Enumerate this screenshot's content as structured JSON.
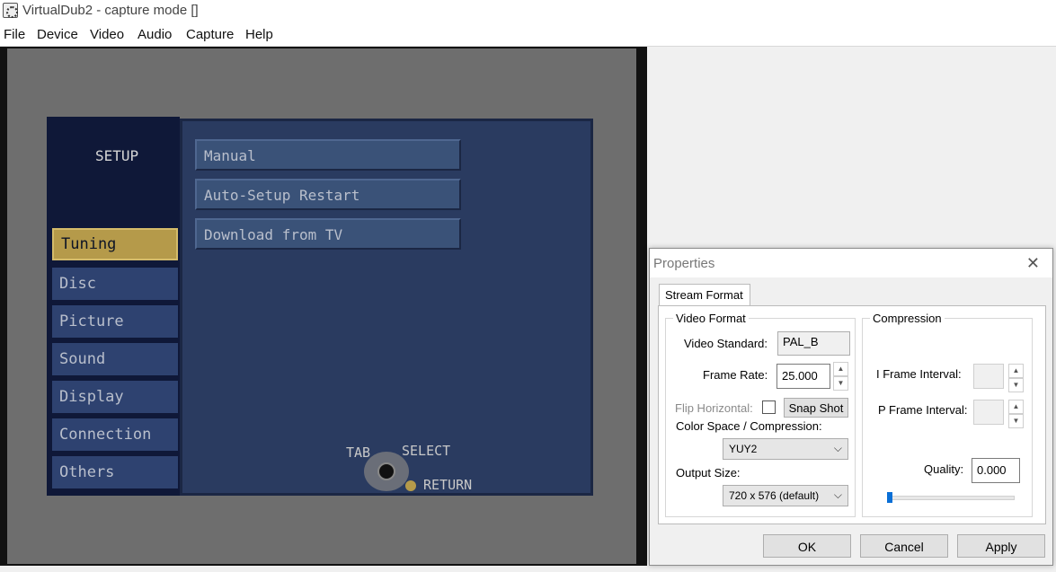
{
  "window": {
    "title": "VirtualDub2  - capture mode []"
  },
  "menu": [
    "File",
    "Device",
    "Video",
    "Audio",
    "Capture",
    "Help"
  ],
  "osd": {
    "title": "SETUP",
    "tabs": [
      "Tuning",
      "Disc",
      "Picture",
      "Sound",
      "Display",
      "Connection",
      "Others"
    ],
    "options": [
      "Manual",
      "Auto-Setup Restart",
      "Download from TV"
    ],
    "nav": {
      "tab": "TAB",
      "select": "SELECT",
      "return": "RETURN"
    }
  },
  "dialog": {
    "title": "Properties",
    "tab": "Stream Format",
    "video_format": {
      "label": "Video Format",
      "video_standard_label": "Video Standard:",
      "video_standard_value": "PAL_B",
      "frame_rate_label": "Frame Rate:",
      "frame_rate_value": "25.000",
      "flip_horizontal_label": "Flip Horizontal:",
      "snap_shot_label": "Snap Shot",
      "color_space_label": "Color Space / Compression:",
      "color_space_value": "YUY2",
      "output_size_label": "Output Size:",
      "output_size_value": "720 x 576  (default)"
    },
    "compression": {
      "label": "Compression",
      "i_frame_label": "I Frame Interval:",
      "p_frame_label": "P Frame Interval:",
      "quality_label": "Quality:",
      "quality_value": "0.000",
      "quality_level": 0
    },
    "buttons": {
      "ok": "OK",
      "cancel": "Cancel",
      "apply": "Apply"
    }
  }
}
